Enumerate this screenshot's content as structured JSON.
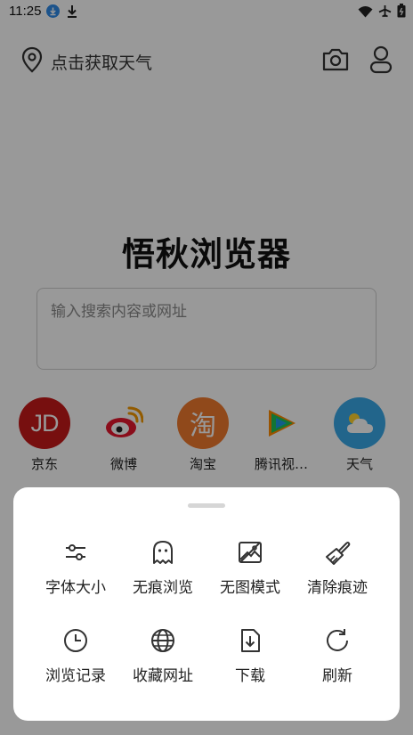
{
  "status_bar": {
    "time": "11:25",
    "icons": [
      "download-badge-icon",
      "download-icon",
      "wifi-icon",
      "airplane-icon",
      "battery-icon"
    ]
  },
  "header": {
    "weather_prompt": "点击获取天气",
    "icons": [
      "location-icon",
      "camera-icon",
      "user-icon"
    ]
  },
  "app_title": "悟秋浏览器",
  "search": {
    "placeholder": "输入搜索内容或网址",
    "value": ""
  },
  "shortcuts": [
    {
      "label": "京东",
      "logo_text": "JD",
      "color": "#c71a1a"
    },
    {
      "label": "微博",
      "logo_text": "",
      "color": "#ffffff"
    },
    {
      "label": "淘宝",
      "logo_text": "淘",
      "color": "#f07a2e"
    },
    {
      "label": "腾讯视…",
      "logo_text": "",
      "color": "#ffffff"
    },
    {
      "label": "天气",
      "logo_text": "",
      "color": "#3aa8e8"
    }
  ],
  "menu": {
    "items": [
      {
        "label": "字体大小",
        "icon": "sliders-icon"
      },
      {
        "label": "无痕浏览",
        "icon": "ghost-icon"
      },
      {
        "label": "无图模式",
        "icon": "image-off-icon"
      },
      {
        "label": "清除痕迹",
        "icon": "brush-icon"
      },
      {
        "label": "浏览记录",
        "icon": "clock-icon"
      },
      {
        "label": "收藏网址",
        "icon": "globe-icon"
      },
      {
        "label": "下载",
        "icon": "download-file-icon"
      },
      {
        "label": "刷新",
        "icon": "refresh-icon"
      }
    ]
  },
  "colors": {
    "scrim": "#000000",
    "accent_blue": "#2f8ae8",
    "sheet_bg": "#ffffff"
  }
}
